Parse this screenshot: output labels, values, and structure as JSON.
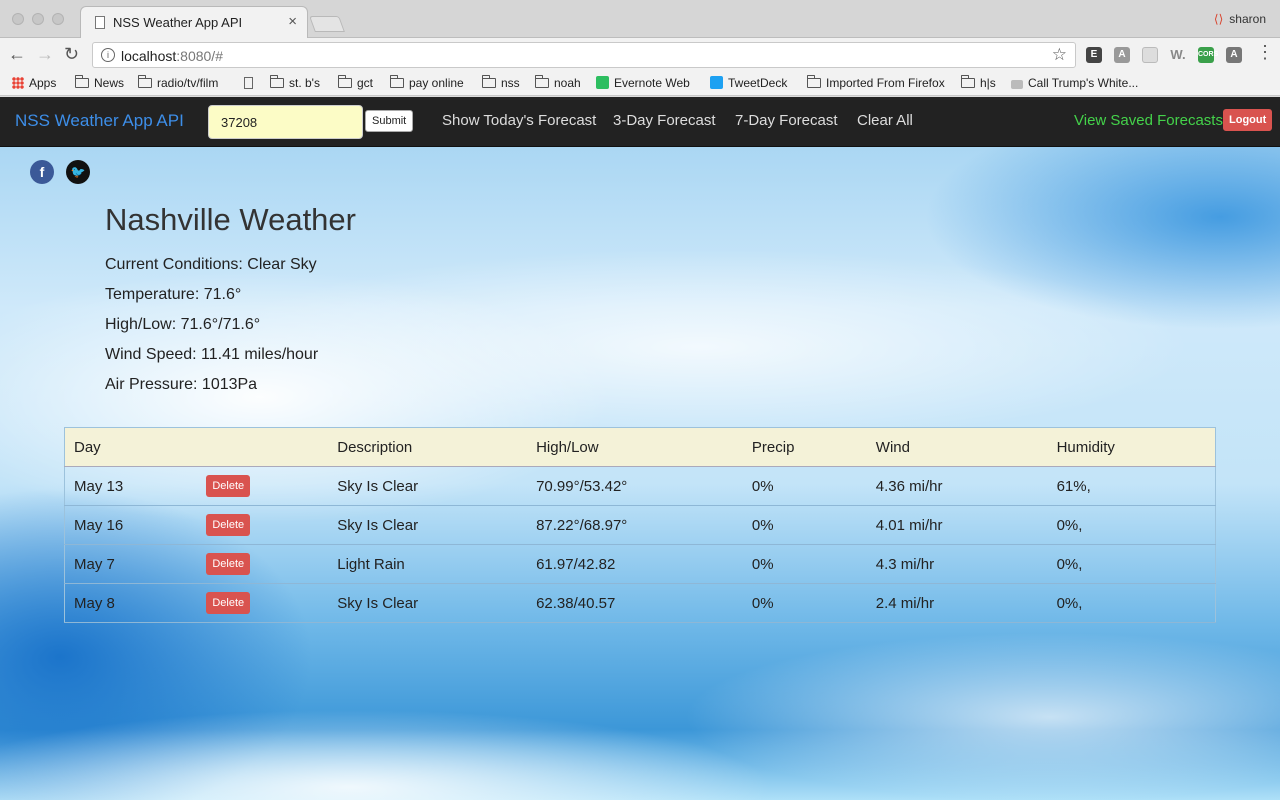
{
  "browser": {
    "tab_title": "NSS Weather App API",
    "tab_close": "×",
    "profile": "sharon",
    "url_host": "localhost",
    "url_rest": ":8080/#",
    "bookmarks": [
      "Apps",
      "News",
      "radio/tv/film",
      "st. b's",
      "gct",
      "pay online",
      "nss",
      "noah",
      "Evernote Web",
      "TweetDeck",
      "Imported From Firefox",
      "h|s",
      "Call Trump's White..."
    ]
  },
  "nav": {
    "brand": "NSS Weather App API",
    "zip_value": "37208",
    "submit": "Submit",
    "links": [
      "Show Today's Forecast",
      "3-Day Forecast",
      "7-Day Forecast",
      "Clear All"
    ],
    "saved": "View Saved Forecasts",
    "logout": "Logout"
  },
  "weather": {
    "city": "Nashville Weather",
    "conditions": "Current Conditions: Clear Sky",
    "temperature": "Temperature: 71.6°",
    "highlow": "High/Low: 71.6°/71.6°",
    "wind": "Wind Speed: 11.41 miles/hour",
    "pressure": "Air Pressure: 1013Pa"
  },
  "table": {
    "headers": [
      "Day",
      "",
      "Description",
      "High/Low",
      "Precip",
      "Wind",
      "Humidity"
    ],
    "delete_label": "Delete",
    "rows": [
      {
        "day": "May 13",
        "desc": "Sky Is Clear",
        "hl": "70.99°/53.42°",
        "precip": "0%",
        "wind": "4.36 mi/hr",
        "humidity": "61%,"
      },
      {
        "day": "May 16",
        "desc": "Sky Is Clear",
        "hl": "87.22°/68.97°",
        "precip": "0%",
        "wind": "4.01 mi/hr",
        "humidity": "0%,"
      },
      {
        "day": "May 7",
        "desc": "Light Rain",
        "hl": "61.97/42.82",
        "precip": "0%",
        "wind": "4.3 mi/hr",
        "humidity": "0%,"
      },
      {
        "day": "May 8",
        "desc": "Sky Is Clear",
        "hl": "62.38/40.57",
        "precip": "0%",
        "wind": "2.4 mi/hr",
        "humidity": "0%,"
      }
    ]
  },
  "colors": {
    "brand": "#3d8ee8",
    "saved_link": "#44d24a",
    "danger": "#d9534f",
    "input_bg": "#fcfcc6",
    "table_header": "#f4f2d8"
  }
}
